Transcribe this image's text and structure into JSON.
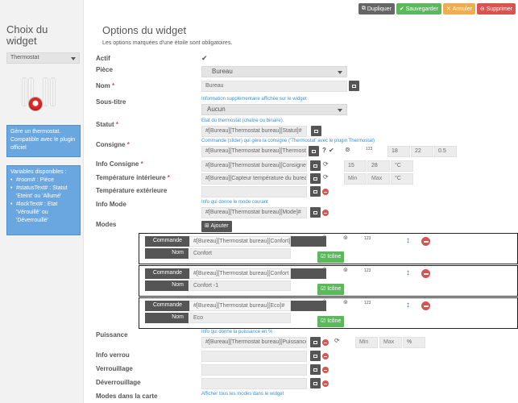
{
  "toolbar": {
    "duplicate": "Dupliquer",
    "save": "Sauvegarder",
    "cancel": "Annuler",
    "delete": "Supprimer"
  },
  "sidebar": {
    "title": "Choix du widget",
    "selected": "Thermostat",
    "description": "Gère un thermostat. Compatible avec le plugin officiel",
    "vars_title": "Variables disponibles :",
    "vars": [
      "#room# : Pièce",
      "#statusText# : Statut 'Eteint' ou 'Allumé'",
      "#lockText# : Etat 'Vérouillé' ou 'Déverrouillé'"
    ]
  },
  "main": {
    "title": "Options du widget",
    "subtitle": "Les options marquées d'une étoile sont obligatoires.",
    "fields": {
      "actif": "Actif",
      "piece": "Pièce",
      "piece_value": "Bureau",
      "nom": "Nom",
      "nom_value": "Bureau",
      "sous_titre": "Sous-titre",
      "sous_titre_hint": "Information supplémentaire affichée sur le widget",
      "sous_titre_value": "Aucun",
      "statut": "Statut",
      "statut_hint": "Etat du thermostat (chaîne ou binaire).",
      "statut_value": "#[Bureau][Thermostat bureau][Statut]#",
      "consigne": "Consigne",
      "consigne_hint": "Commande (slider) qui gère la consigne ('Thermostat' avec le plugin Thermostat)",
      "consigne_value": "#[Bureau][Thermostat bureau][Thermostat]",
      "consigne_min": "18",
      "consigne_max": "22",
      "consigne_step": "0.5",
      "info_consigne": "Info Consigne",
      "info_consigne_value": "#[Bureau][Thermostat bureau][Consigne]#",
      "info_consigne_min": "15",
      "info_consigne_max": "28",
      "info_consigne_unit": "°C",
      "temp_int": "Température intérieure",
      "temp_int_value": "#[Bureau][Capteur température du bureau][",
      "temp_int_min": "Min",
      "temp_int_max": "Max",
      "temp_int_unit": "°C",
      "temp_ext": "Température extérieure",
      "info_mode": "Info Mode",
      "info_mode_hint": "Info qui donne le mode courant",
      "info_mode_value": "#[Bureau][Thermostat bureau][Mode]#",
      "modes": "Modes",
      "add": "Ajouter",
      "puissance": "Puissance",
      "puissance_hint": "Info qui donne la puissance en %",
      "puissance_value": "#[Bureau][Thermostat bureau][Puissance]#",
      "puissance_min": "Min",
      "puissance_max": "Max",
      "puissance_unit": "%",
      "info_verrou": "Info verrou",
      "verrouillage": "Verrouillage",
      "deverrouillage": "Déverrouillage",
      "modes_carte": "Modes dans la carte",
      "modes_carte_hint": "Afficher tous les modes dans le widget"
    },
    "modes": [
      {
        "commande_label": "Commande",
        "commande": "#[Bureau][Thermostat bureau][Confort]#",
        "nom_label": "Nom",
        "nom": "Confort",
        "icone": "Icône"
      },
      {
        "commande_label": "Commande",
        "commande": "#[Bureau][Thermostat bureau][Confort -1",
        "nom_label": "Nom",
        "nom": "Confort -1",
        "icone": "Icône"
      },
      {
        "commande_label": "Commande",
        "commande": "#[Bureau][Thermostat bureau][Eco]#",
        "nom_label": "Nom",
        "nom": "Eco",
        "icone": "Icône"
      }
    ]
  }
}
